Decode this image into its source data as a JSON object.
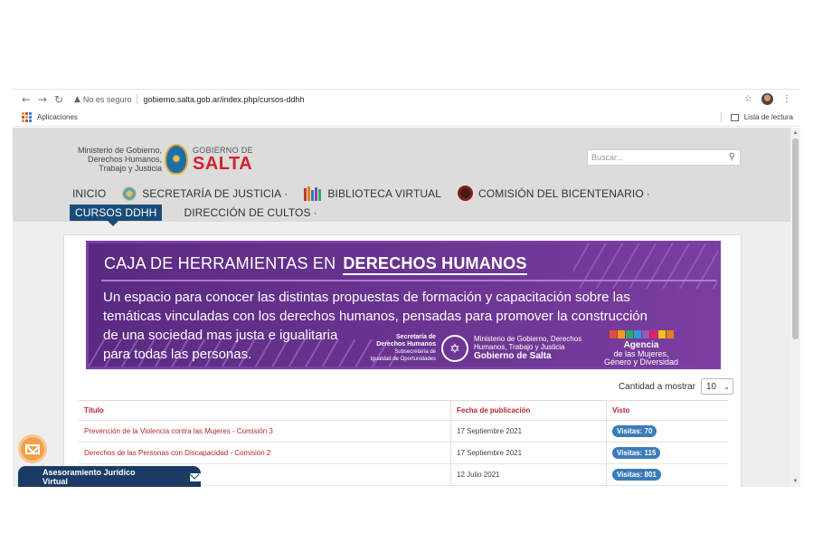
{
  "browser": {
    "back_icon": "arrow-left-icon",
    "forward_icon": "arrow-right-icon",
    "reload_icon": "reload-icon",
    "security_label": "No es seguro",
    "url": "gobierno.salta.gob.ar/index.php/cursos-ddhh",
    "bookmark_icon": "star-icon",
    "apps_label": "Aplicaciones",
    "reading_list_label": "Lista de lectura"
  },
  "site": {
    "ministry": [
      "Ministerio de Gobierno,",
      "Derechos Humanos,",
      "Trabajo y Justicia"
    ],
    "gov_small": "GOBIERNO DE",
    "gov_big": "SALTA",
    "search_placeholder": "Buscar..."
  },
  "menu": {
    "items": [
      {
        "label": "INICIO"
      },
      {
        "label": "SECRETARÍA DE JUSTICIA",
        "caret": "·"
      },
      {
        "label": "BIBLIOTECA VIRTUAL"
      },
      {
        "label": "COMISIÓN DEL BICENTENARIO",
        "caret": "·"
      },
      {
        "label": "CURSOS DDHH"
      },
      {
        "label": "DIRECCIÓN DE CULTOS",
        "caret": "·"
      }
    ]
  },
  "banner": {
    "title_a": "CAJA DE HERRAMIENTAS EN",
    "title_b": "DERECHOS HUMANOS",
    "description_lines": [
      "Un espacio para conocer las distintas propuestas de formación y capacitación sobre las",
      "temáticas vinculadas con los derechos humanos, pensadas para promover la construcción",
      "de una sociedad mas justa e igualitaria",
      "para todas las personas."
    ],
    "sec_title": [
      "Secretaría de",
      "Derechos Humanos"
    ],
    "sec_sub": [
      "Subsecretaría de",
      "Igualdad de Oportunidades"
    ],
    "ministry_lines": [
      "Ministerio de Gobierno, Derechos",
      "Humanos, Trabajo y Justicia"
    ],
    "ministry_bold": "Gobierno de Salta",
    "agencia_title": "Agencia",
    "agencia_lines": [
      "de las Mujeres,",
      "Género y Diversidad"
    ]
  },
  "table": {
    "qty_label": "Cantidad a mostrar",
    "qty_value": "10",
    "headers": {
      "title": "Título",
      "date": "Fecha de publicación",
      "views": "Visto"
    },
    "rows": [
      {
        "title": "Prevención de la Violencia contra las Mujeres - Comisión 3",
        "date": "17 Septiembre 2021",
        "views": "Visitas: 70"
      },
      {
        "title": "Derechos de las Personas con Discapacidad - Comisión 2",
        "date": "17 Septiembre 2021",
        "views": "Visitas: 115"
      },
      {
        "title": "",
        "date": "12 Julio 2021",
        "views": "Visitas: 801"
      }
    ]
  },
  "widgets": {
    "advice_label": "Asesoramiento Jurídico Virtual"
  },
  "colors": {
    "accent_red": "#b3282d",
    "nav_blue": "#1a4c7a",
    "banner_purple": "#5a2a82",
    "badge_blue": "#3a7cb8",
    "advice_navy": "#1a3c64",
    "mail_orange": "#f0a24a"
  }
}
